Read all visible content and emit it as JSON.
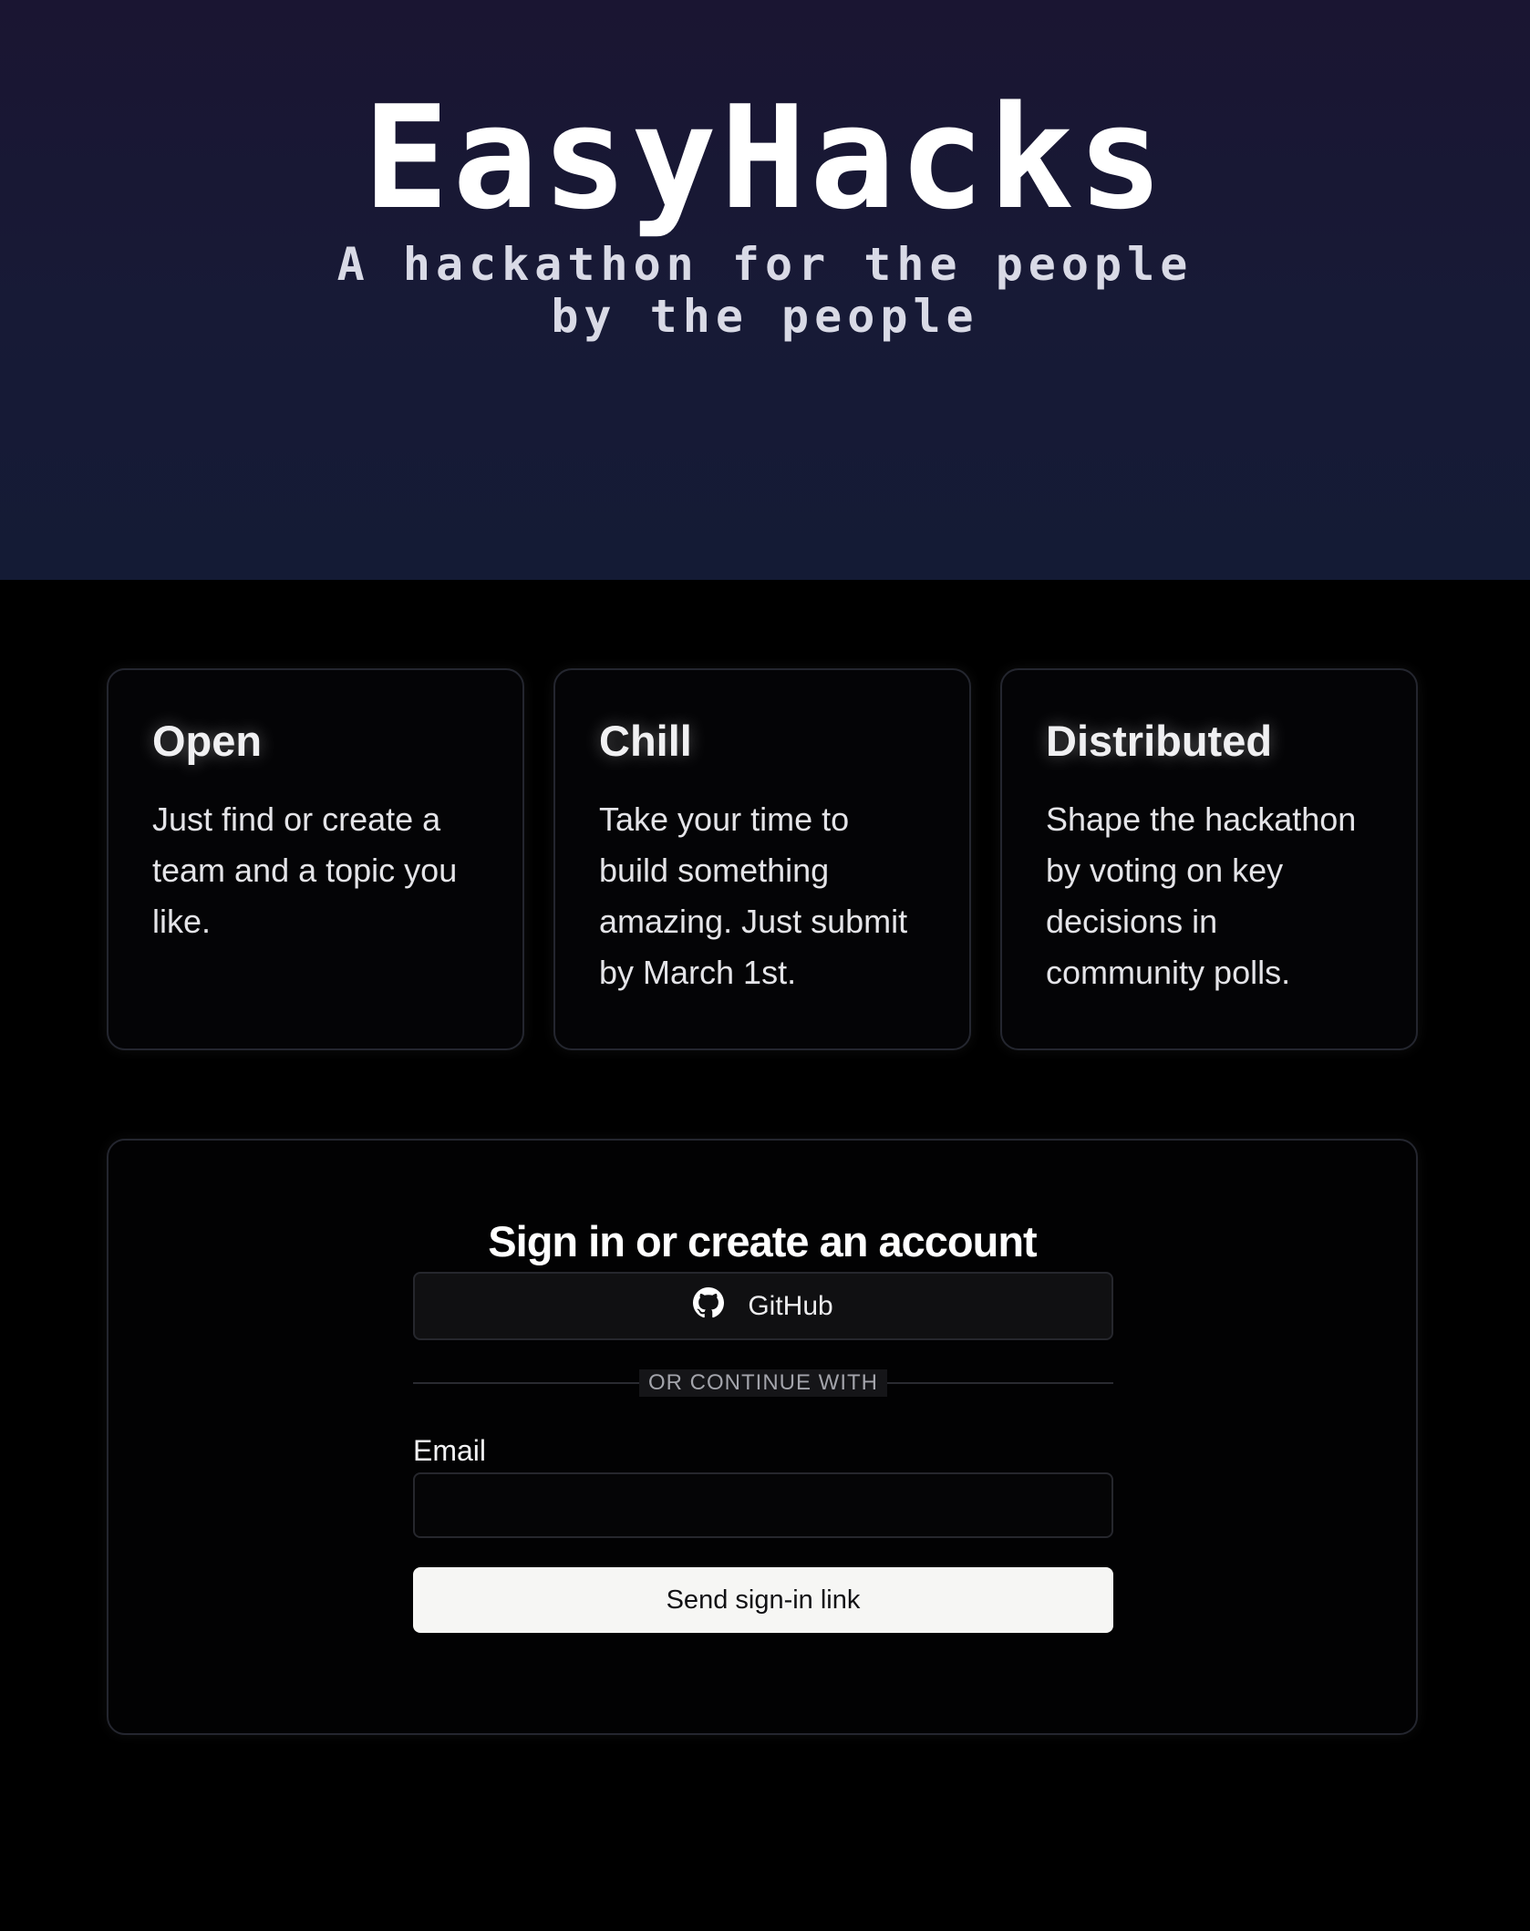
{
  "hero": {
    "title": "EasyHacks",
    "subtitle_line1": "A hackathon for the people",
    "subtitle_line2": "by the people"
  },
  "features": [
    {
      "title": "Open",
      "text": "Just find or create a team and a topic you like."
    },
    {
      "title": "Chill",
      "text": "Take your time to build something amazing. Just submit by March 1st."
    },
    {
      "title": "Distributed",
      "text": "Shape the hackathon by voting on key decisions in community polls."
    }
  ],
  "signin": {
    "title": "Sign in or create an account",
    "github_label": "GitHub",
    "divider_label": "OR CONTINUE WITH",
    "email_label": "Email",
    "email_value": "",
    "email_placeholder": "",
    "submit_label": "Send sign-in link"
  },
  "icons": {
    "github": "github-icon"
  },
  "colors": {
    "hero_bg_top": "#1a1532",
    "hero_bg_bottom": "#141b35",
    "page_bg": "#000000",
    "card_border": "#24262f",
    "primary_button_bg": "#f6f6f4"
  }
}
